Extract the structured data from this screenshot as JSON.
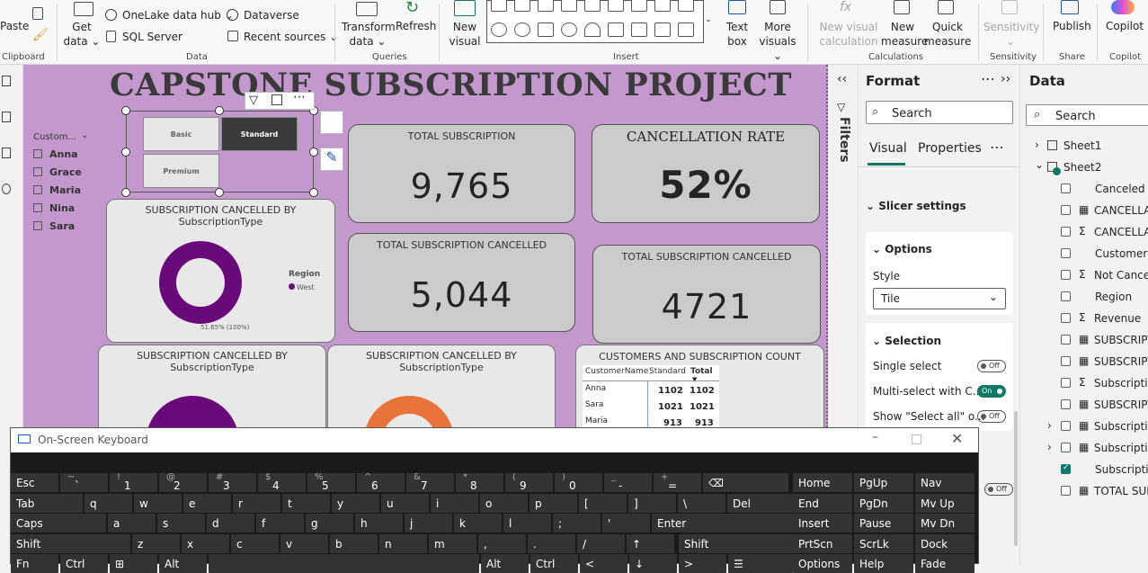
{
  "ribbon": {
    "clipboard": {
      "paste": "Paste",
      "group": "Clipboard"
    },
    "data": {
      "get_data": "Get data",
      "onelake": "OneLake data hub",
      "dataverse": "Dataverse",
      "sql": "SQL Server",
      "recent": "Recent sources",
      "group": "Data"
    },
    "queries": {
      "transform": "Transform data",
      "refresh": "Refresh",
      "group": "Queries"
    },
    "insert": {
      "new_visual": "New visual",
      "text_box": "Text box",
      "more_visuals": "More visuals",
      "group": "Insert"
    },
    "calculations": {
      "new_visual_calc": "New visual calculation",
      "new_measure": "New measure",
      "quick_measure": "Quick measure",
      "group": "Calculations"
    },
    "sensitivity": {
      "label": "Sensitivity",
      "group": "Sensitivity"
    },
    "share": {
      "publish": "Publish",
      "group": "Share"
    },
    "copilot": {
      "label": "Copilot",
      "group": "Copilot"
    }
  },
  "report": {
    "title": "CAPSTONE SUBSCRIPTION PROJECT",
    "customer_slicer": {
      "header": "Custom...",
      "items": [
        "Anna",
        "Grace",
        "Maria",
        "Nina",
        "Sara"
      ]
    },
    "type_slicer": {
      "tiles": [
        "Basic",
        "Standard",
        "Premium"
      ],
      "selected": "Standard"
    },
    "cards": {
      "total_subscription": {
        "title": "TOTAL SUBSCRIPTION",
        "value": "9,765"
      },
      "cancellation_rate": {
        "title": "CANCELLATION RATE",
        "value": "52%"
      },
      "total_cancelled_1": {
        "title": "TOTAL SUBSCRIPTION CANCELLED",
        "value": "5,044"
      },
      "total_cancelled_2": {
        "title": "TOTAL SUBSCRIPTION CANCELLED",
        "value": "4721"
      }
    },
    "donut1": {
      "title": "SUBSCRIPTION CANCELLED BY SubscriptionType",
      "legend_title": "Region",
      "legend_item": "West",
      "data_label": "51.65% (100%)"
    },
    "donut2": {
      "title": "SUBSCRIPTION CANCELLED BY SubscriptionType"
    },
    "donut3": {
      "title": "SUBSCRIPTION CANCELLED BY SubscriptionType"
    },
    "table": {
      "title": "CUSTOMERS AND SUBSCRIPTION COUNT",
      "headers": [
        "CustomerName",
        "Standard",
        "Total"
      ],
      "rows": [
        [
          "Anna",
          "1102",
          "1102"
        ],
        [
          "Sara",
          "1021",
          "1021"
        ],
        [
          "Maria",
          "913",
          "913"
        ]
      ]
    },
    "colors": {
      "canvas": "#c398cc",
      "donut_purple": "#6a0a7a",
      "donut_orange": "#e8743b"
    }
  },
  "filters_label": "Filters",
  "format_pane": {
    "title": "Format",
    "search_placeholder": "Search",
    "tabs": [
      "Visual",
      "Properties"
    ],
    "section_slicer": "Slicer settings",
    "options": {
      "title": "Options",
      "style_label": "Style",
      "style_value": "Tile"
    },
    "selection": {
      "title": "Selection",
      "single": {
        "label": "Single select",
        "state": "Off"
      },
      "multi": {
        "label": "Multi-select with C...",
        "state": "On"
      },
      "select_all": {
        "label": "Show \"Select all\" o...",
        "state": "Off"
      },
      "extra": {
        "state": "Off"
      }
    }
  },
  "data_pane": {
    "title": "Data",
    "search_placeholder": "Search",
    "tables": [
      "Sheet1",
      "Sheet2"
    ],
    "fields": [
      {
        "name": "Canceled",
        "type": "",
        "checked": false
      },
      {
        "name": "CANCELLAT",
        "type": "table",
        "checked": false
      },
      {
        "name": "CANCELLAT",
        "type": "sigma",
        "checked": false
      },
      {
        "name": "CustomerN",
        "type": "",
        "checked": false
      },
      {
        "name": "Not Cancel",
        "type": "sigma",
        "checked": false
      },
      {
        "name": "Region",
        "type": "",
        "checked": false
      },
      {
        "name": "Revenue",
        "type": "sigma",
        "checked": false
      },
      {
        "name": "SUBSCRIPT",
        "type": "calc",
        "checked": false
      },
      {
        "name": "SUBSCRIPT",
        "type": "table",
        "checked": false
      },
      {
        "name": "Subscriptio",
        "type": "sigma",
        "checked": false
      },
      {
        "name": "SUBSCRIPT",
        "type": "table",
        "checked": false
      },
      {
        "name": "Subscriptio",
        "type": "table",
        "checked": false
      },
      {
        "name": "Subscriptio",
        "type": "table",
        "checked": false
      },
      {
        "name": "Subscriptio",
        "type": "",
        "checked": true
      },
      {
        "name": "TOTAL SUB",
        "type": "table",
        "checked": false
      }
    ]
  },
  "keyboard": {
    "title": "On-Screen Keyboard",
    "row1": [
      [
        "Esc",
        ""
      ],
      [
        "`",
        "~"
      ],
      [
        "1",
        "!"
      ],
      [
        "2",
        "@"
      ],
      [
        "3",
        "#"
      ],
      [
        "4",
        "$"
      ],
      [
        "5",
        "%"
      ],
      [
        "6",
        "^"
      ],
      [
        "7",
        "&"
      ],
      [
        "8",
        "*"
      ],
      [
        "9",
        "("
      ],
      [
        "0",
        ")"
      ],
      [
        "-",
        "_"
      ],
      [
        "=",
        "+"
      ],
      [
        "⌫",
        ""
      ]
    ],
    "row2": [
      "Tab",
      "q",
      "w",
      "e",
      "r",
      "t",
      "y",
      "u",
      "i",
      "o",
      "p",
      "[",
      "]",
      "\\",
      "Del"
    ],
    "row3": [
      "Caps",
      "a",
      "s",
      "d",
      "f",
      "g",
      "h",
      "j",
      "k",
      "l",
      ";",
      "'",
      "Enter"
    ],
    "row4": [
      "Shift",
      "z",
      "x",
      "c",
      "v",
      "b",
      "n",
      "m",
      ",",
      ".",
      "/",
      "↑",
      "Shift"
    ],
    "row5": [
      "Fn",
      "Ctrl",
      "⊞",
      "Alt",
      "",
      "Alt",
      "Ctrl",
      "<",
      "↓",
      ">",
      "☰"
    ],
    "nav": [
      [
        "Home",
        "PgUp",
        "Nav"
      ],
      [
        "End",
        "PgDn",
        "Mv Up"
      ],
      [
        "Insert",
        "Pause",
        "Mv Dn"
      ],
      [
        "PrtScn",
        "ScrLk",
        "Dock"
      ],
      [
        "Options",
        "Help",
        "Fade"
      ]
    ]
  }
}
